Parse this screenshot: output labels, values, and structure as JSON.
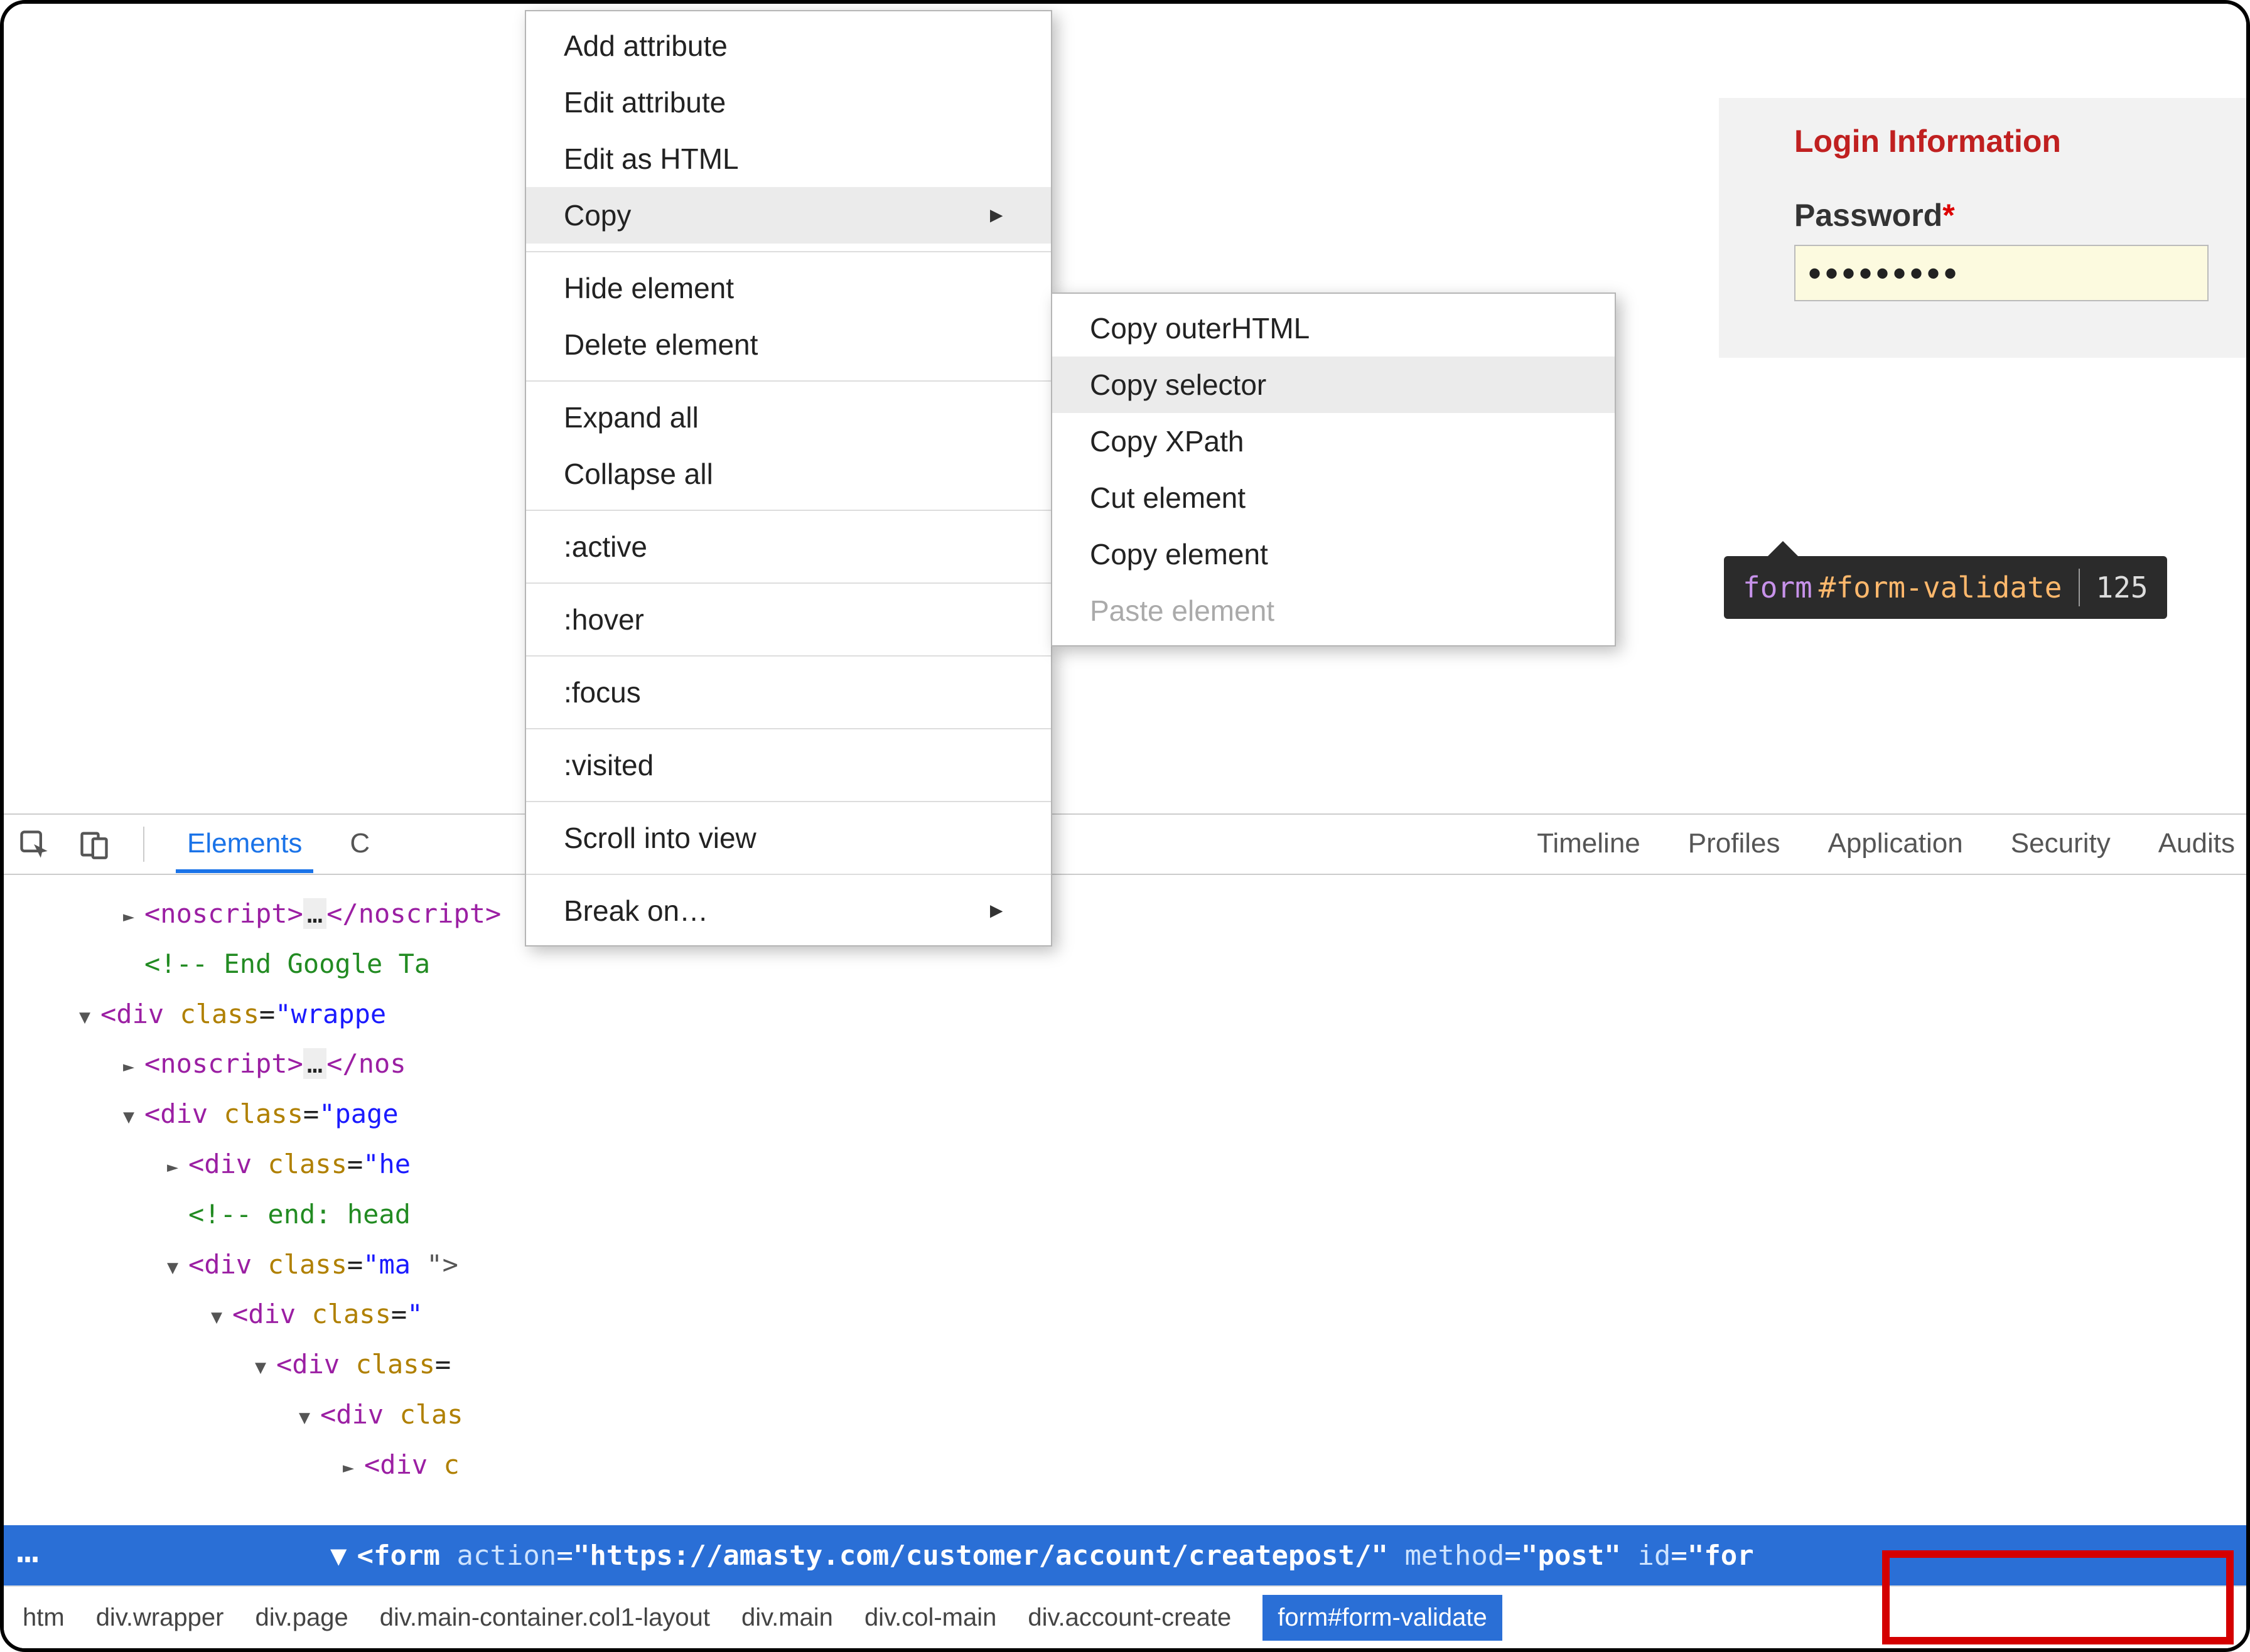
{
  "page": {
    "login_heading": "Login Information",
    "password_label": "Password",
    "required_marker": "*",
    "password_value": "•••••••••"
  },
  "tooltip": {
    "tag": "form",
    "id_selector": "#form-validate",
    "dimensions": "125"
  },
  "devtools": {
    "tabs": {
      "elements": "Elements",
      "console_initial": "C",
      "timeline_partial": "Timeline",
      "profiles_partial": "Profiles",
      "application": "Application",
      "security": "Security",
      "audits": "Audits"
    },
    "dom_lines": [
      {
        "indent": 1,
        "caret": "right",
        "html": "<span class='tag'>&lt;noscript&gt;</span><span class='ellips'>…</span><span class='tag'>&lt;/noscript&gt;</span>"
      },
      {
        "indent": 1,
        "caret": "",
        "html": "<span class='cm'>&lt;!-- End Google Ta</span>"
      },
      {
        "indent": 0,
        "caret": "down",
        "html": "<span class='tag'>&lt;div</span> <span class='attr-n'>class</span>=<span class='attr-v'>\"wrappe</span>"
      },
      {
        "indent": 1,
        "caret": "right",
        "html": "<span class='tag'>&lt;noscript&gt;</span><span class='ellips'>…</span><span class='tag'>&lt;/nos</span>"
      },
      {
        "indent": 1,
        "caret": "down",
        "html": "<span class='tag'>&lt;div</span> <span class='attr-n'>class</span>=<span class='attr-v'>\"page</span>"
      },
      {
        "indent": 2,
        "caret": "right",
        "html": "<span class='tag'>&lt;div</span> <span class='attr-n'>class</span>=<span class='attr-v'>\"he</span>"
      },
      {
        "indent": 2,
        "caret": "",
        "html": "<span class='cm'>&lt;!-- end: head</span>"
      },
      {
        "indent": 2,
        "caret": "down",
        "html": "<span class='tag'>&lt;div</span> <span class='attr-n'>class</span>=<span class='attr-v'>\"ma</span>                                     <span style='color:#555'>\"&gt;</span>"
      },
      {
        "indent": 3,
        "caret": "down",
        "html": "<span class='tag'>&lt;div</span> <span class='attr-n'>class</span>=<span class='attr-v'>\"</span>"
      },
      {
        "indent": 4,
        "caret": "down",
        "html": "<span class='tag'>&lt;div</span> <span class='attr-n'>class</span>="
      },
      {
        "indent": 5,
        "caret": "down",
        "html": "<span class='tag'>&lt;div</span> <span class='attr-n'>clas</span>"
      },
      {
        "indent": 6,
        "caret": "right",
        "html": "<span class='tag'>&lt;div</span> <span class='attr-n'>c</span>"
      }
    ],
    "selected_line": {
      "prefix": "…",
      "tag_open": "<form",
      "attrs": [
        {
          "n": "action",
          "v": "\"https://amasty.com/customer/account/createpost/\""
        },
        {
          "n": "method",
          "v": "\"post\""
        },
        {
          "n": "id",
          "v": "\"for"
        }
      ]
    },
    "breadcrumbs": [
      "htm",
      "div.wrapper",
      "div.page",
      "div.main-container.col1-layout",
      "div.main",
      "div.col-main",
      "div.account-create",
      "form#form-validate"
    ]
  },
  "context_menu_1": {
    "items": [
      {
        "label": "Add attribute"
      },
      {
        "label": "Edit attribute"
      },
      {
        "label": "Edit as HTML"
      },
      {
        "label": "Copy",
        "submenu": true,
        "hover": true
      },
      {
        "sep": true
      },
      {
        "label": "Hide element"
      },
      {
        "label": "Delete element"
      },
      {
        "sep": true
      },
      {
        "label": "Expand all"
      },
      {
        "label": "Collapse all"
      },
      {
        "sep": true
      },
      {
        "label": ":active"
      },
      {
        "sep": true
      },
      {
        "label": ":hover"
      },
      {
        "sep": true
      },
      {
        "label": ":focus"
      },
      {
        "sep": true
      },
      {
        "label": ":visited"
      },
      {
        "sep": true
      },
      {
        "label": "Scroll into view"
      },
      {
        "sep": true
      },
      {
        "label": "Break on…",
        "submenu": true
      }
    ]
  },
  "context_menu_2": {
    "items": [
      {
        "label": "Copy outerHTML"
      },
      {
        "label": "Copy selector",
        "hover": true
      },
      {
        "label": "Copy XPath"
      },
      {
        "label": "Cut element"
      },
      {
        "label": "Copy element"
      },
      {
        "label": "Paste element",
        "disabled": true
      }
    ]
  }
}
